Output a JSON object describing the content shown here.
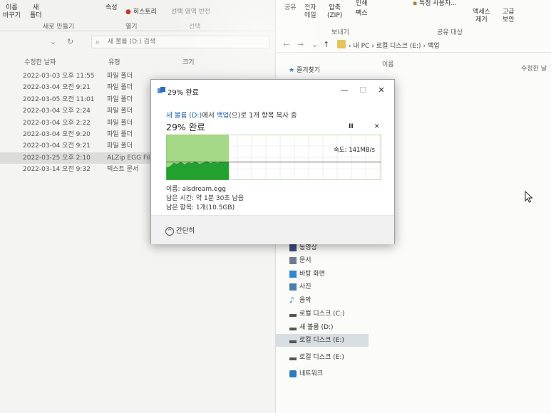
{
  "left_explorer": {
    "ribbon": {
      "btn_rename": "이름\n바꾸기",
      "btn_new_folder": "새\n폴더",
      "btn_properties": "속성",
      "btn_history": "히스토리",
      "btn_select_reverse": "선택 영역 반전",
      "group_new": "새로 만들기",
      "group_open": "열기",
      "group_select": "선택"
    },
    "search_placeholder": "새 볼륨 (D:) 검색",
    "columns": {
      "modified": "수정한 날짜",
      "type": "유형",
      "size": "크기"
    },
    "rows": [
      {
        "date": "2022-03-03 오후 11:55",
        "type": "파일 폴더"
      },
      {
        "date": "2022-03-04 오전 9:21",
        "type": "파일 폴더"
      },
      {
        "date": "2022-03-05 오전 11:01",
        "type": "파일 폴더"
      },
      {
        "date": "2022-03-04 오후 2:24",
        "type": "파일 폴더"
      },
      {
        "date": "2022-03-04 오후 2:22",
        "type": "파일 폴더"
      },
      {
        "date": "2022-03-04 오전 9:20",
        "type": "파일 폴더"
      },
      {
        "date": "2022-03-04 오전 9:21",
        "type": "파일 폴더"
      },
      {
        "date": "2022-03-25 오후 2:10",
        "type": "ALZip EGG File"
      },
      {
        "date": "2022-03-14 오전 9:32",
        "type": "텍스트 문서"
      }
    ],
    "selected_row_index": 7
  },
  "right_explorer": {
    "ribbon": {
      "btn_share": "공유",
      "btn_email": "전자\n메일",
      "btn_zip": "압축\n(ZIP)",
      "btn_print": "인쇄",
      "btn_fax": "팩스",
      "btn_specific_users": "특정 사용자...",
      "btn_remove_access": "액세스\n제거",
      "btn_advanced_security": "고급\n보안",
      "group_send": "보내기",
      "group_share_with": "공유 대상"
    },
    "breadcrumb": [
      "내 PC",
      "로컬 디스크 (E:)",
      "백업"
    ],
    "columns": {
      "name": "이름",
      "modified": "수정한 날"
    },
    "quick_access": "즐겨찾기",
    "nav_items": [
      {
        "label": "동영상",
        "icon": "video-icon",
        "color": "#3a4d7a"
      },
      {
        "label": "문서",
        "icon": "document-icon",
        "color": "#6f7c8c"
      },
      {
        "label": "바탕 화면",
        "icon": "desktop-icon",
        "color": "#2f86d6"
      },
      {
        "label": "사진",
        "icon": "pictures-icon",
        "color": "#4b7db3"
      },
      {
        "label": "음악",
        "icon": "music-icon",
        "color": "#2f6fbf"
      },
      {
        "label": "로컬 디스크 (C:)",
        "icon": "drive-icon",
        "color": "#555555"
      },
      {
        "label": "새 볼륨 (D:)",
        "icon": "drive-icon",
        "color": "#555555"
      },
      {
        "label": "로컬 디스크 (E:)",
        "icon": "drive-icon",
        "color": "#555555"
      },
      {
        "label": "로컬 디스크 (E:)",
        "icon": "drive-icon",
        "color": "#555555"
      },
      {
        "label": "네트워크",
        "icon": "network-icon",
        "color": "#2d7ac0"
      }
    ],
    "selected_nav_index": 7
  },
  "dialog": {
    "title": "29% 완료",
    "source": "새 볼륨 (D:)",
    "text_from": "에서",
    "destination": "백업",
    "text_rest": "(으)로 1개 항목 복사 중",
    "percent_label": "29% 완료",
    "pause_glyph": "II",
    "cancel_glyph": "✕",
    "speed_label": "속도: 141MB/s",
    "file_name": "이름: alsdream.egg",
    "time_remaining": "남은 시간: 약 1분 30초 남음",
    "items_remaining": "남은 항목: 1개(10.5GB)",
    "collapse_label": "간단히",
    "minimize_glyph": "—",
    "maximize_glyph": "☐",
    "close_glyph": "✕"
  },
  "chart_data": {
    "type": "area",
    "title": "",
    "progress_fraction": 0.29,
    "current_speed": "141MB/s",
    "colors": {
      "done_fill": "#22a12e",
      "done_bg": "#a6d987",
      "line": "#2e7d32",
      "remaining_bg": "#ffffff"
    },
    "series": [
      {
        "values": [
          0.28,
          0.3,
          0.38,
          0.36,
          0.4,
          0.35,
          0.39,
          0.37,
          0.41,
          0.36,
          0.38,
          0.42,
          0.37,
          0.4,
          0.38,
          0.41,
          0.39,
          0.4
        ]
      }
    ]
  }
}
